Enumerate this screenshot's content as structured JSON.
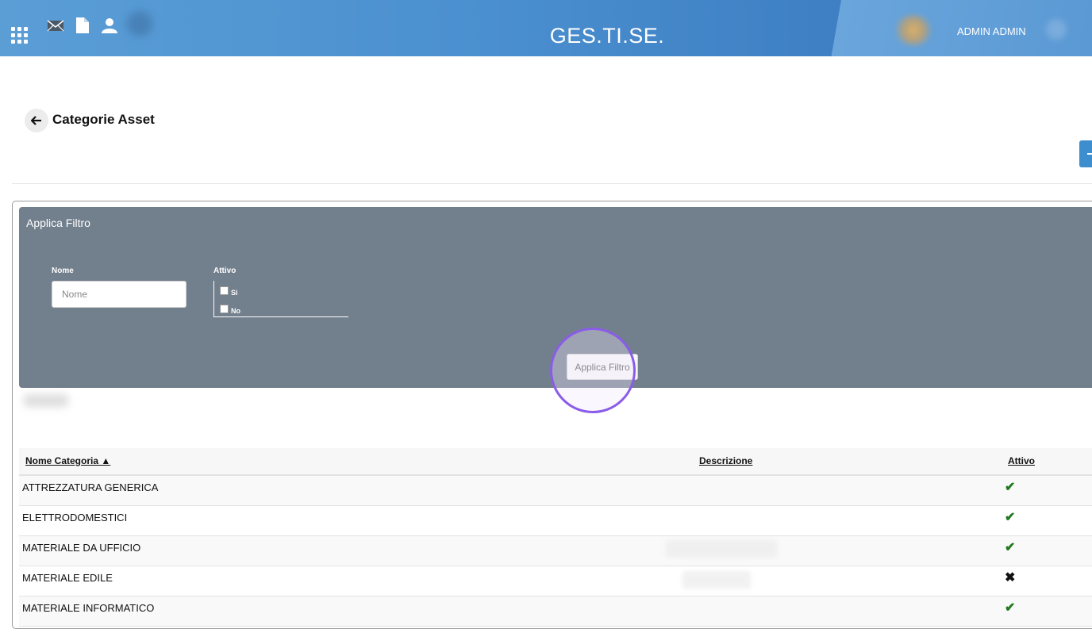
{
  "header": {
    "brand": "GES.TI.SE.",
    "user": "ADMIN ADMIN",
    "icons": [
      "apps-grid-icon",
      "mail-icon",
      "document-icon",
      "user-icon"
    ]
  },
  "page": {
    "title": "Categorie Asset"
  },
  "filter": {
    "title": "Applica Filtro",
    "name_label": "Nome",
    "name_placeholder": "Nome",
    "name_value": "",
    "attivo_label": "Attivo",
    "options": [
      {
        "label": "Si",
        "checked": false
      },
      {
        "label": "No",
        "checked": false
      }
    ],
    "apply_label": "Applica Filtro"
  },
  "table": {
    "columns": [
      "Nome Categoria ▲",
      "Descrizione",
      "Attivo"
    ],
    "rows": [
      {
        "name": "ATTREZZATURA GENERICA",
        "descrizione": "",
        "attivo": "✔"
      },
      {
        "name": "ELETTRODOMESTICI",
        "descrizione": "",
        "attivo": "✔"
      },
      {
        "name": "MATERIALE DA UFFICIO",
        "descrizione": "",
        "attivo": "✔"
      },
      {
        "name": "MATERIALE EDILE",
        "descrizione": "",
        "attivo": "✖"
      },
      {
        "name": "MATERIALE INFORMATICO",
        "descrizione": "",
        "attivo": "✔"
      }
    ]
  },
  "colors": {
    "topbar": "#4a8fcf",
    "filter_panel": "#727f8d",
    "active_check": "#1f7a1f",
    "add_button": "#3d8ecf",
    "click_ring": "#8a5ce8"
  }
}
